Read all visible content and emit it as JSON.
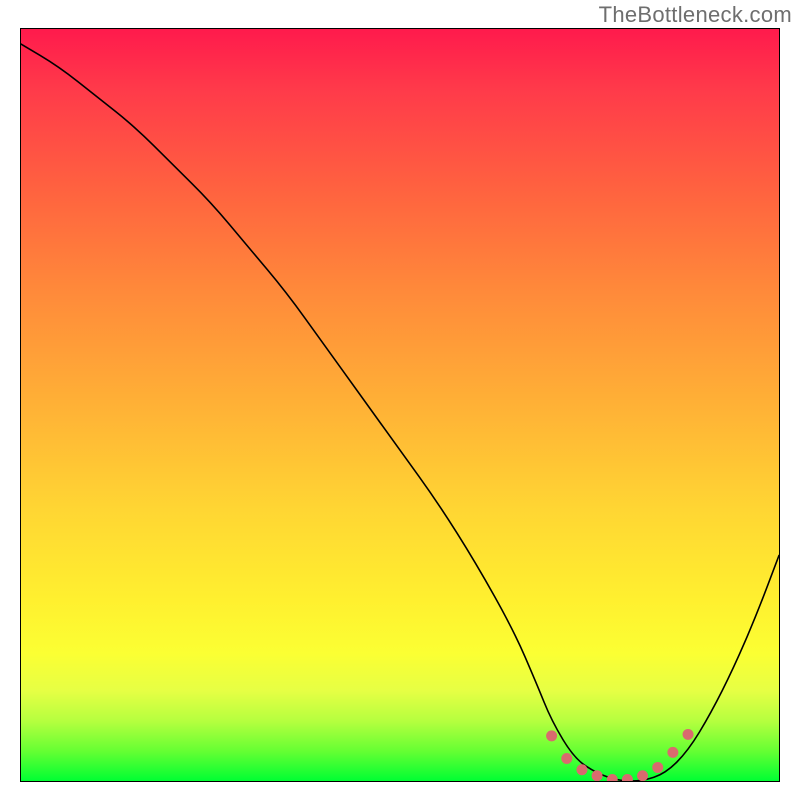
{
  "watermark": "TheBottleneck.com",
  "chart_data": {
    "type": "line",
    "title": "",
    "xlabel": "",
    "ylabel": "",
    "xlim": [
      0,
      100
    ],
    "ylim": [
      0,
      100
    ],
    "series": [
      {
        "name": "bottleneck-curve",
        "x": [
          0,
          5,
          10,
          15,
          20,
          25,
          30,
          35,
          40,
          45,
          50,
          55,
          60,
          65,
          68,
          70,
          73,
          76,
          79,
          82,
          85,
          88,
          91,
          94,
          97,
          100
        ],
        "y": [
          98,
          95,
          91,
          87,
          82,
          77,
          71,
          65,
          58,
          51,
          44,
          37,
          29,
          20,
          13,
          8,
          3,
          1,
          0,
          0,
          1,
          4,
          9,
          15,
          22,
          30
        ]
      },
      {
        "name": "optimal-range-dots",
        "x": [
          70,
          72,
          74,
          76,
          78,
          80,
          82,
          84,
          86,
          88
        ],
        "y": [
          6,
          3,
          1.5,
          0.7,
          0.2,
          0.2,
          0.7,
          1.8,
          3.8,
          6.2
        ]
      }
    ],
    "gradient_stops": [
      {
        "pos": 0,
        "color": "#ff1a4c"
      },
      {
        "pos": 50,
        "color": "#ffb136"
      },
      {
        "pos": 83,
        "color": "#fbff33"
      },
      {
        "pos": 100,
        "color": "#00ff33"
      }
    ]
  }
}
